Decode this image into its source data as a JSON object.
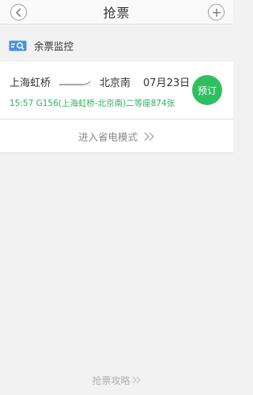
{
  "header": {
    "title": "抢票",
    "back_icon": "chevron-left-icon",
    "add_icon": "plus-icon"
  },
  "section": {
    "label": "余票监控",
    "icon": "ticket-search-icon"
  },
  "ticket": {
    "from": "上海虹桥",
    "to": "北京南",
    "date": "07月23日",
    "detail": "15:57 G156(上海虹桥-北京南)二等座874张",
    "book_label": "预订"
  },
  "power_save": {
    "label": "进入省电模式"
  },
  "strategy": {
    "label": "抢票攻略"
  },
  "colors": {
    "accent_green": "#2fbf5f",
    "detail_green": "#2bb061",
    "icon_blue": "#3a8ee6"
  }
}
